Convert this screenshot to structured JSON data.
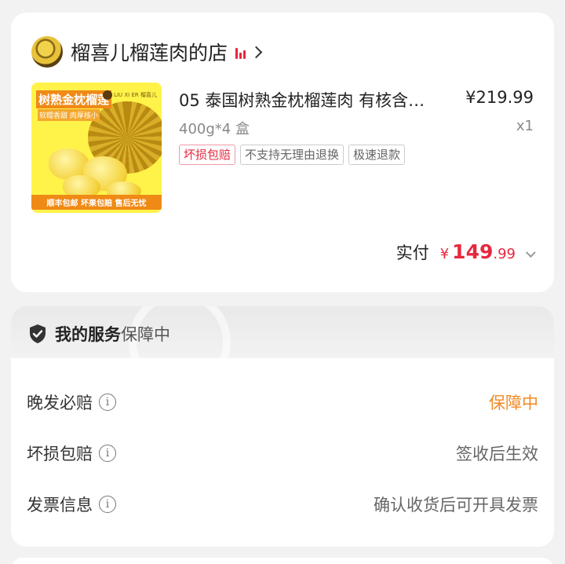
{
  "shop": {
    "name": "榴喜儿榴莲肉的店"
  },
  "product": {
    "title": "05 泰国树熟金枕榴莲肉 有核含…",
    "price": "¥219.99",
    "spec": "400g*4 盒",
    "qty": "x1",
    "tags": [
      "坏损包赔",
      "不支持无理由退换",
      "极速退款"
    ],
    "thumb": {
      "title": "树熟金枕榴莲",
      "subtitle": "软糯香甜 肉厚核小",
      "logo": "LIU XI ER 榴喜儿",
      "footer": "顺丰包邮 坏果包赔 售后无忧"
    }
  },
  "payment": {
    "label": "实付",
    "currency": "¥",
    "amount_int": "149",
    "amount_dec": ".99"
  },
  "services": {
    "title": "我的服务",
    "status": "保障中",
    "rows": [
      {
        "label": "晚发必赔",
        "value": "保障中"
      },
      {
        "label": "坏损包赔",
        "value": "签收后生效"
      },
      {
        "label": "发票信息",
        "value": "确认收货后可开具发票"
      }
    ]
  },
  "colors": {
    "accent_red": "#e6283e",
    "accent_orange": "#f08a24"
  },
  "icons": [
    "shop-logo",
    "signal-bars-icon",
    "chevron-right-icon",
    "chevron-down-icon",
    "shield-check-icon",
    "info-icon"
  ]
}
